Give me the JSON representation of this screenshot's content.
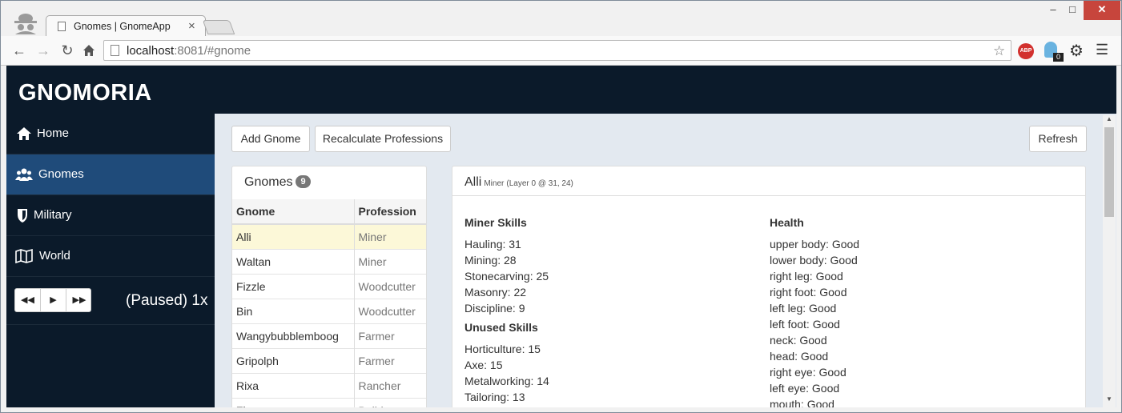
{
  "browser": {
    "tab_title": "Gnomes | GnomeApp",
    "tab_close": "×",
    "url_host": "localhost",
    "url_rest": ":8081/#gnome",
    "window_min": "–",
    "window_max": "□",
    "window_close": "✕",
    "extension_badge": "0",
    "abp_label": "ABP"
  },
  "app": {
    "brand": "GNOMORIA"
  },
  "sidebar": {
    "items": [
      {
        "label": "Home",
        "icon": "home-icon"
      },
      {
        "label": "Gnomes",
        "icon": "users-icon"
      },
      {
        "label": "Military",
        "icon": "shield-icon"
      },
      {
        "label": "World",
        "icon": "map-icon"
      }
    ],
    "speed": "(Paused) 1x"
  },
  "toolbar": {
    "add_label": "Add Gnome",
    "recalc_label": "Recalculate Professions",
    "refresh_label": "Refresh"
  },
  "gnome_list": {
    "title": "Gnomes",
    "count": "9",
    "headers": {
      "gnome": "Gnome",
      "profession": "Profession"
    },
    "rows": [
      {
        "name": "Alli",
        "profession": "Miner"
      },
      {
        "name": "Waltan",
        "profession": "Miner"
      },
      {
        "name": "Fizzle",
        "profession": "Woodcutter"
      },
      {
        "name": "Bin",
        "profession": "Woodcutter"
      },
      {
        "name": "Wangybubblemboog",
        "profession": "Farmer"
      },
      {
        "name": "Gripolph",
        "profession": "Farmer"
      },
      {
        "name": "Rixa",
        "profession": "Rancher"
      },
      {
        "name": "Zi..",
        "profession": "Build.."
      }
    ],
    "selected_index": 0
  },
  "detail": {
    "name": "Alli",
    "profession": "Miner",
    "location": "(Layer 0 @ 31, 24)",
    "skills_title": "Miner Skills",
    "skills": [
      "Hauling: 31",
      "Mining: 28",
      "Stonecarving: 25",
      "Masonry: 22",
      "Discipline: 9"
    ],
    "unused_title": "Unused Skills",
    "unused": [
      "Horticulture: 15",
      "Axe: 15",
      "Metalworking: 14",
      "Tailoring: 13"
    ],
    "health_title": "Health",
    "health": [
      "upper body: Good",
      "lower body: Good",
      "right leg: Good",
      "right foot: Good",
      "left leg: Good",
      "left foot: Good",
      "neck: Good",
      "head: Good",
      "right eye: Good",
      "left eye: Good",
      "mouth: Good"
    ]
  }
}
